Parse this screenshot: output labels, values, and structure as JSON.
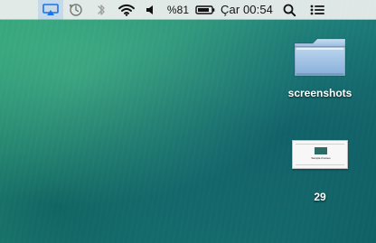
{
  "menubar": {
    "battery_percent_text": "%81",
    "clock_text": "Çar 00:54",
    "icons": {
      "airplay": "airplay-icon",
      "time_machine": "time-machine-icon",
      "bluetooth": "bluetooth-icon",
      "wifi": "wifi-icon",
      "volume": "volume-icon",
      "battery": "battery-icon",
      "spotlight": "search-icon",
      "notification_center": "notification-center-icon"
    }
  },
  "desktop": {
    "folder_label": "screenshots",
    "file_label": "29",
    "thumbnail_text": "Sample Frames"
  },
  "colors": {
    "menubar_bg": "#f0f0f0",
    "airplay_blue": "#1a73e8",
    "folder_blue": "#a9c7e8"
  }
}
